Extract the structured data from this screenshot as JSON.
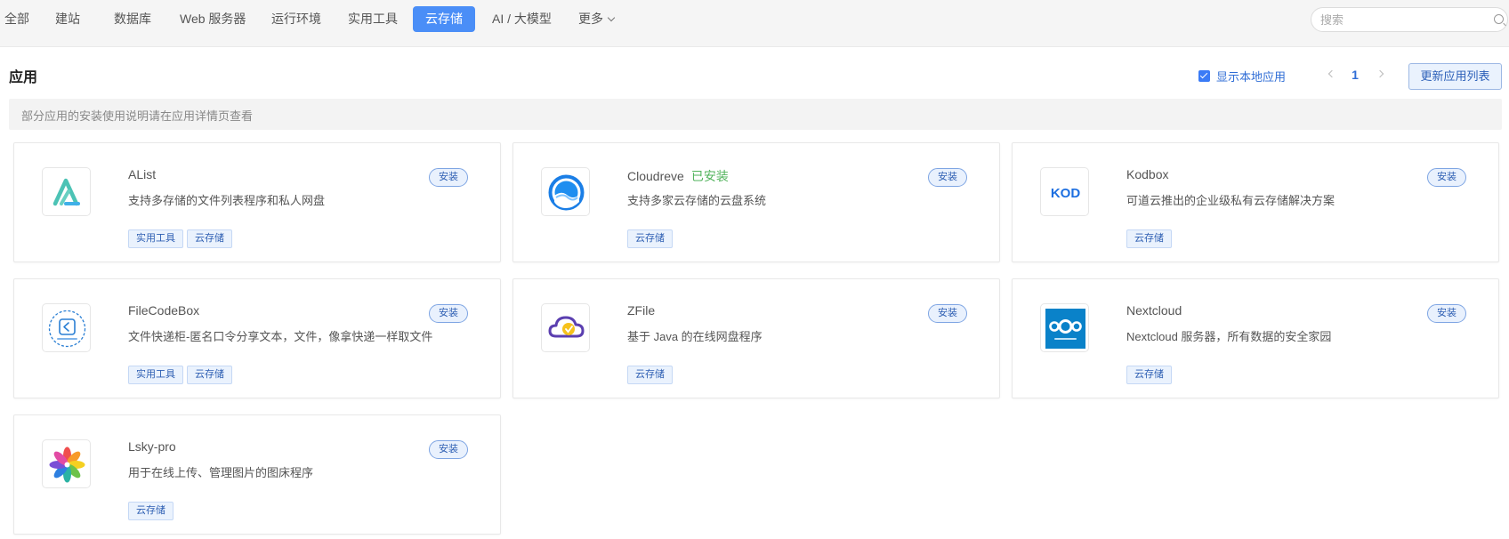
{
  "nav": {
    "items": [
      "全部",
      "建站",
      "数据库",
      "Web 服务器",
      "运行环境",
      "实用工具",
      "云存储",
      "AI / 大模型",
      "更多"
    ],
    "active_index": 6
  },
  "search": {
    "placeholder": "搜索"
  },
  "section": {
    "title": "应用",
    "show_local_label": "显示本地应用",
    "show_local_checked": true,
    "page": "1",
    "refresh_label": "更新应用列表",
    "notice": "部分应用的安装使用说明请在应用详情页查看"
  },
  "apps": [
    {
      "name": "AList",
      "installed": "",
      "desc": "支持多存储的文件列表程序和私人网盘",
      "tags": [
        "实用工具",
        "云存储"
      ],
      "install_label": "安装",
      "icon": "alist-logo-icon"
    },
    {
      "name": "Cloudreve",
      "installed": "已安装",
      "desc": "支持多家云存储的云盘系统",
      "tags": [
        "云存储"
      ],
      "install_label": "安装",
      "icon": "cloudreve-logo-icon"
    },
    {
      "name": "Kodbox",
      "installed": "",
      "desc": "可道云推出的企业级私有云存储解决方案",
      "tags": [
        "云存储"
      ],
      "install_label": "安装",
      "icon": "kodbox-logo-icon",
      "icon_text": "KOD"
    },
    {
      "name": "FileCodeBox",
      "installed": "",
      "desc": "文件快递柜-匿名口令分享文本，文件，像拿快递一样取文件",
      "tags": [
        "实用工具",
        "云存储"
      ],
      "install_label": "安装",
      "icon": "filecodebox-logo-icon"
    },
    {
      "name": "ZFile",
      "installed": "",
      "desc": "基于 Java 的在线网盘程序",
      "tags": [
        "云存储"
      ],
      "install_label": "安装",
      "icon": "zfile-logo-icon"
    },
    {
      "name": "Nextcloud",
      "installed": "",
      "desc": "Nextcloud 服务器，所有数据的安全家园",
      "tags": [
        "云存储"
      ],
      "install_label": "安装",
      "icon": "nextcloud-logo-icon"
    },
    {
      "name": "Lsky-pro",
      "installed": "",
      "desc": "用于在线上传、管理图片的图床程序",
      "tags": [
        "云存储"
      ],
      "install_label": "安装",
      "icon": "lsky-pro-logo-icon"
    }
  ],
  "colors": {
    "accent": "#4a8ef7",
    "installed_green": "#52b35c",
    "link_blue": "#2f6dd6"
  }
}
